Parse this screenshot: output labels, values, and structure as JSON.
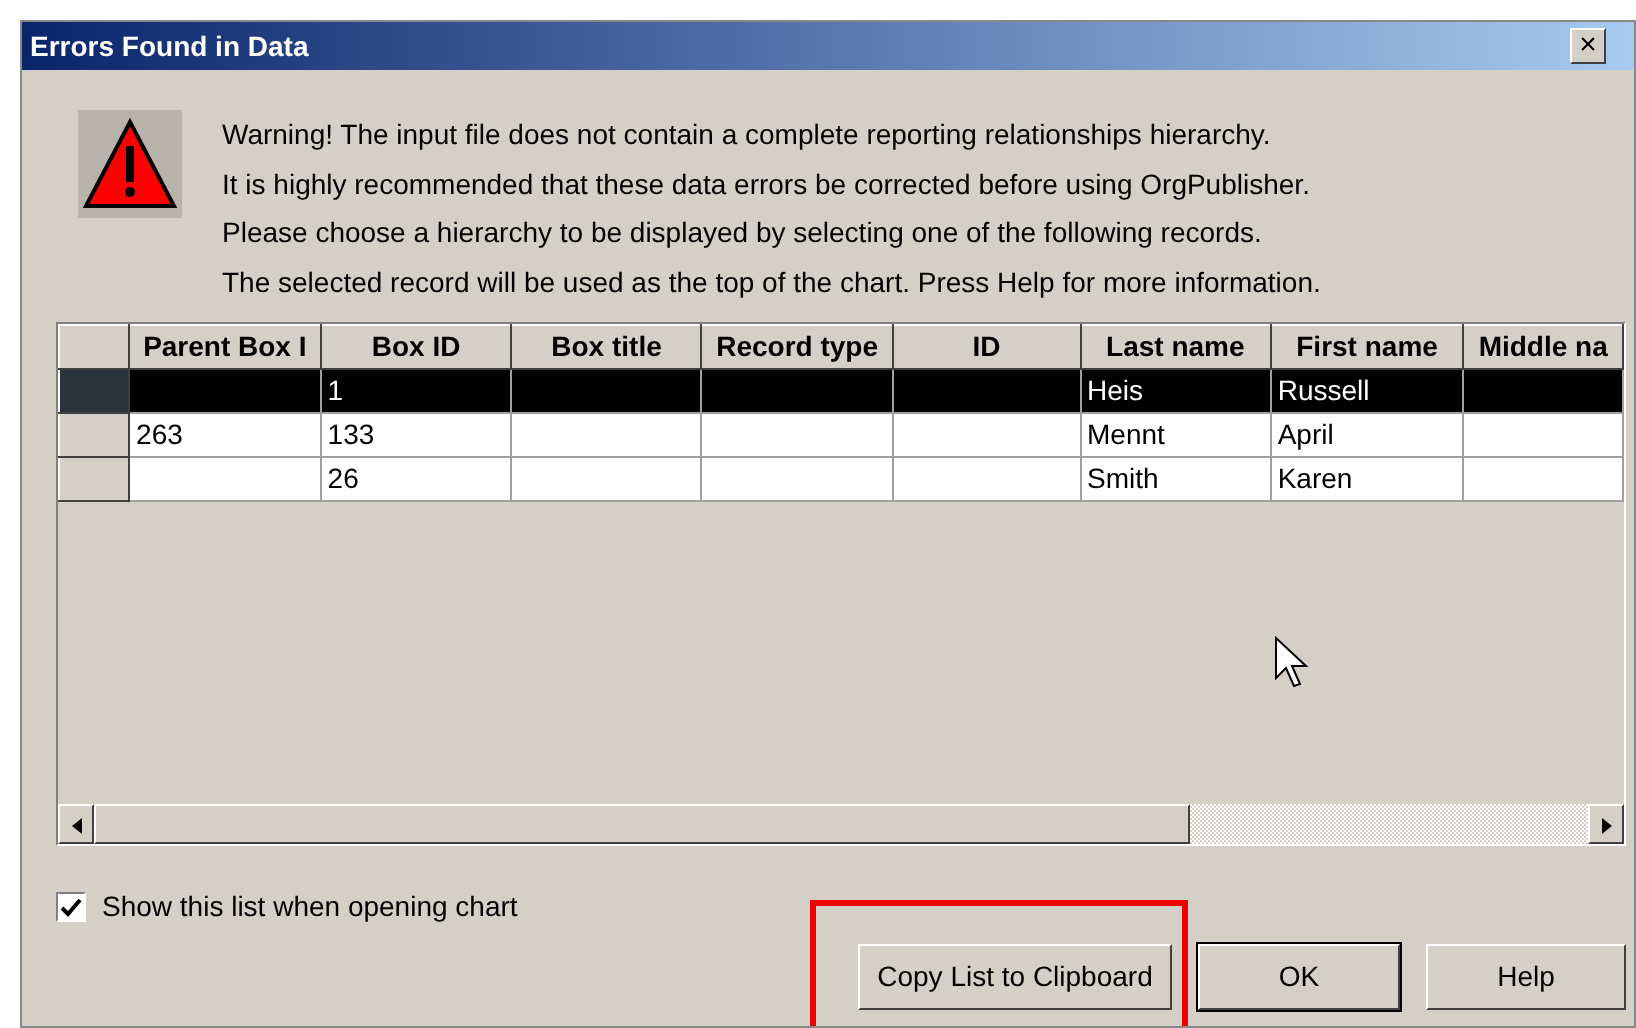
{
  "window": {
    "title": "Errors Found in Data",
    "close": "×"
  },
  "message": [
    "Warning! The input file does not contain a complete reporting relationships hierarchy.",
    "It is highly recommended that these data errors be corrected before using OrgPublisher.",
    "Please choose a hierarchy to be displayed by selecting one of the following records.",
    "The selected record will be used as the top of the chart. Press Help for more information."
  ],
  "table": {
    "columns": [
      "Parent Box I",
      "Box ID",
      "Box title",
      "Record type",
      "ID",
      "Last name",
      "First name",
      "Middle na"
    ],
    "rows": [
      {
        "selected": true,
        "cells": [
          "",
          "1",
          "",
          "",
          "",
          "Heis",
          "Russell",
          ""
        ]
      },
      {
        "selected": false,
        "cells": [
          "263",
          "133",
          "",
          "",
          "",
          "Mennt",
          "April",
          ""
        ]
      },
      {
        "selected": false,
        "cells": [
          "",
          "26",
          "",
          "",
          "",
          "Smith",
          "Karen",
          ""
        ]
      }
    ]
  },
  "checkbox": {
    "label": "Show this list when opening chart",
    "checked": true
  },
  "buttons": [
    {
      "label": "Copy List to Clipboard",
      "highlighted": true,
      "default": false
    },
    {
      "label": "OK",
      "highlighted": false,
      "default": true
    },
    {
      "label": "Help",
      "highlighted": false,
      "default": false
    }
  ]
}
